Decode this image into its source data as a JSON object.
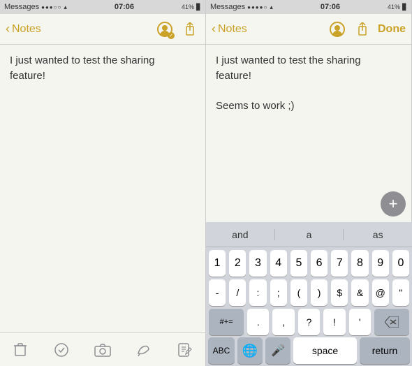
{
  "left_panel": {
    "status": {
      "app": "Messages",
      "signal": "●●●○○",
      "wifi": "▾",
      "time": "07:06",
      "battery_pct": "41%",
      "battery_icon": "🔋"
    },
    "nav": {
      "back_label": "Notes",
      "share_icon": "⬆",
      "done_label": ""
    },
    "content": {
      "text": "I just wanted to test the sharing\nfeature!"
    },
    "toolbar": {
      "trash_icon": "🗑",
      "check_icon": "✓",
      "camera_icon": "📷",
      "draw_icon": "✏",
      "compose_icon": "📝"
    }
  },
  "right_panel": {
    "status": {
      "app": "Messages",
      "signal": "●●●●○",
      "wifi": "▾",
      "time": "07:06",
      "battery_pct": "41%",
      "battery_icon": "🔋"
    },
    "nav": {
      "back_label": "Notes",
      "share_icon": "⬆",
      "done_label": "Done"
    },
    "content": {
      "text": "I just wanted to test the sharing\nfeature!\n\nSeems to work ;)"
    },
    "plus_button": "+",
    "keyboard": {
      "suggestions": [
        "and",
        "a",
        "as"
      ],
      "row1": [
        "1",
        "2",
        "3",
        "4",
        "5",
        "6",
        "7",
        "8",
        "9",
        "0"
      ],
      "row2": [
        "-",
        "/",
        ":",
        ";",
        "(",
        ")",
        " $ ",
        "&",
        "@",
        "\""
      ],
      "row3_left": [
        "#+="
      ],
      "row3_mid": [
        ".",
        ",",
        "?",
        "!",
        "'"
      ],
      "row3_right": "⌫",
      "bottom": {
        "abc": "ABC",
        "globe": "🌐",
        "mic": "🎤",
        "space": "space",
        "return": "return"
      }
    }
  }
}
